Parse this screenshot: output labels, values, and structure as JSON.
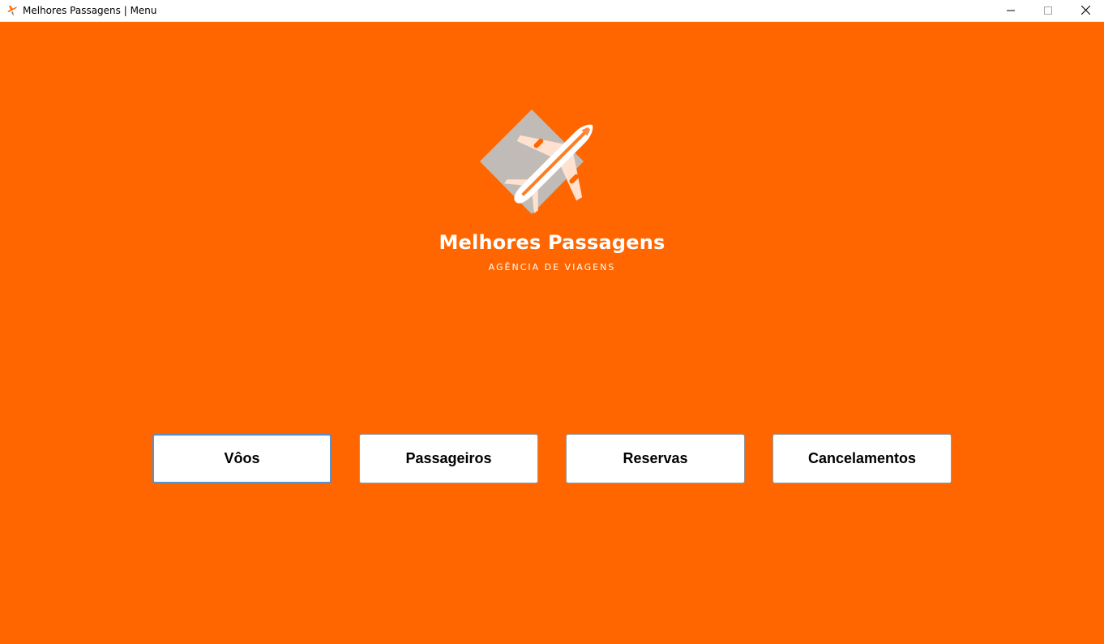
{
  "window": {
    "title": "Melhores Passagens | Menu",
    "app_icon": "airplane-icon",
    "controls": {
      "minimize_icon": "minimize-icon",
      "maximize_icon": "maximize-icon",
      "close_icon": "close-icon"
    }
  },
  "colors": {
    "background": "#ff6600",
    "logo_diamond": "#c0bbb6",
    "button_background": "#ffffff",
    "focus_border": "#5a8fc8"
  },
  "brand": {
    "logo_icon": "airplane-logo",
    "name": "Melhores Passagens",
    "tagline": "AGÊNCIA DE VIAGENS"
  },
  "menu": {
    "buttons": [
      {
        "label": "Vôos",
        "focused": true
      },
      {
        "label": "Passageiros",
        "focused": false
      },
      {
        "label": "Reservas",
        "focused": false
      },
      {
        "label": "Cancelamentos",
        "focused": false
      }
    ]
  }
}
